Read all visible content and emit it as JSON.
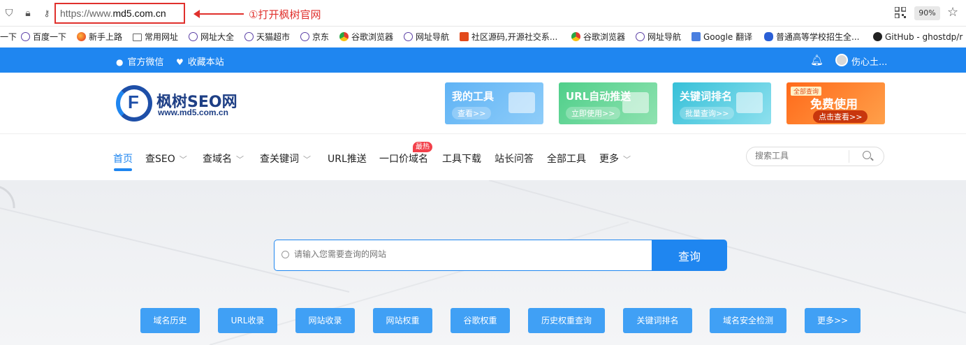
{
  "browser": {
    "url_prefix": "https://www.",
    "url_domain": "md5.com.cn",
    "annotation": "①打开枫树官网",
    "zoom": "90%"
  },
  "bookmarks": [
    {
      "label": "一下",
      "icon": "none"
    },
    {
      "label": "百度一下",
      "icon": "globe-icon"
    },
    {
      "label": "新手上路",
      "icon": "firefox-icon"
    },
    {
      "label": "常用网址",
      "icon": "folder-icon"
    },
    {
      "label": "网址大全",
      "icon": "globe-icon"
    },
    {
      "label": "天猫超市",
      "icon": "globe-icon"
    },
    {
      "label": "京东",
      "icon": "globe-icon"
    },
    {
      "label": "谷歌浏览器",
      "icon": "chrome-icon"
    },
    {
      "label": "网址导航",
      "icon": "globe-icon"
    },
    {
      "label": "社区源码,开源社交系...",
      "icon": "site-icon"
    },
    {
      "label": "谷歌浏览器",
      "icon": "chrome-icon"
    },
    {
      "label": "网址导航",
      "icon": "globe-icon"
    },
    {
      "label": "Google 翻译",
      "icon": "translate-icon"
    },
    {
      "label": "普通高等学校招生全...",
      "icon": "baidu-paw-icon"
    },
    {
      "label": "GitHub - ghostdp/r",
      "icon": "github-icon"
    }
  ],
  "topstrip": {
    "wechat": "官方微信",
    "favorite": "收藏本站",
    "user": "伤心土..."
  },
  "logo": {
    "name": "枫树SEO网",
    "domain": "www.md5.com.cn"
  },
  "cards": [
    {
      "title": "我的工具",
      "button": "查看>>"
    },
    {
      "title": "URL自动推送",
      "button": "立即使用>>"
    },
    {
      "title": "关键词排名",
      "button": "批量查询>>"
    },
    {
      "title": "免费使用",
      "top": "全部查询",
      "button": "点击查看>>"
    }
  ],
  "nav": {
    "items": [
      "首页",
      "查SEO",
      "查域名",
      "查关键词",
      "URL推送",
      "一口价域名",
      "工具下载",
      "站长问答",
      "全部工具",
      "更多"
    ],
    "hot_badge": "最热",
    "search_placeholder": "搜索工具"
  },
  "hero": {
    "search_placeholder": "请输入您需要查询的网站",
    "search_button": "查询",
    "quick_links": [
      "域名历史",
      "URL收录",
      "网站收录",
      "网站权重",
      "谷歌权重",
      "历史权重查询",
      "关键词排名",
      "域名安全检测",
      "更多>>"
    ]
  },
  "colors": {
    "brand_blue": "#1f86f0",
    "annotation_red": "#e0302c",
    "hot_red": "#f2404a"
  }
}
